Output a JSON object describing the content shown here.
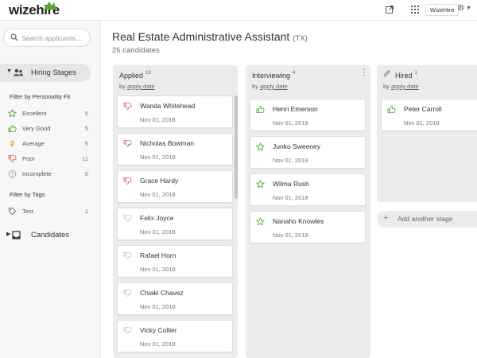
{
  "brand": {
    "logo_text": "wizehire",
    "accent": "#5aa832"
  },
  "topbar": {
    "org_label": "WizeHire"
  },
  "sidebar": {
    "search_placeholder": "Search applicants...",
    "hiring_stages_label": "Hiring Stages",
    "filter_fit_label": "Filter by Personality Fit",
    "fit_filters": [
      {
        "name": "Excellent",
        "count": "5",
        "icon": "star-icon",
        "color": "#5aa832"
      },
      {
        "name": "Very Good",
        "count": "5",
        "icon": "thumbs-up-icon",
        "color": "#5aa832"
      },
      {
        "name": "Average",
        "count": "5",
        "icon": "lightning-icon",
        "color": "#e2a521"
      },
      {
        "name": "Poor",
        "count": "11",
        "icon": "thumbs-down-icon",
        "color": "#e06a6a"
      },
      {
        "name": "Incomplete",
        "count": "0",
        "icon": "question-circle-icon",
        "color": "#999999"
      }
    ],
    "filter_tags_label": "Filter by Tags",
    "tags": [
      {
        "name": "Test",
        "count": "1",
        "icon": "tag-icon"
      }
    ],
    "candidates_label": "Candidates"
  },
  "job": {
    "title": "Real Estate Administrative Assistant",
    "location": "(TX)",
    "candidate_count": "26 candidates"
  },
  "columns": [
    {
      "name": "Applied",
      "count": "19",
      "sort_prefix": "by",
      "sort_label": "apply date",
      "cards": [
        {
          "name": "Wanda Whitehead",
          "date": "Nov 01, 2018",
          "icon": "thumbs-down-icon"
        },
        {
          "name": "Nicholas Bowman",
          "date": "Nov 01, 2018",
          "icon": "thumbs-down-icon"
        },
        {
          "name": "Grace Hardy",
          "date": "Nov 01, 2018",
          "icon": "thumbs-down-icon"
        },
        {
          "name": "Felix Joyce",
          "date": "Nov 01, 2018",
          "icon": "thumbs-down-icon"
        },
        {
          "name": "Rafael Horn",
          "date": "Nov 01, 2018",
          "icon": "thumbs-down-icon"
        },
        {
          "name": "Chiaki Chavez",
          "date": "Nov 01, 2018",
          "icon": "thumbs-down-icon"
        },
        {
          "name": "Vicky Collier",
          "date": "Nov 01, 2018",
          "icon": "thumbs-down-icon"
        }
      ]
    },
    {
      "name": "Interviewing",
      "count": "4",
      "sort_prefix": "by",
      "sort_label": "apply date",
      "cards": [
        {
          "name": "Henri Emerson",
          "date": "Nov 01, 2018",
          "icon": "thumbs-up-icon"
        },
        {
          "name": "Junko Sweeney",
          "date": "Nov 01, 2018",
          "icon": "star-icon"
        },
        {
          "name": "Wilma Rush",
          "date": "Nov 01, 2018",
          "icon": "star-icon"
        },
        {
          "name": "Nanaho Knowles",
          "date": "Nov 01, 2018",
          "icon": "star-icon"
        }
      ]
    },
    {
      "name": "Hired",
      "count": "1",
      "sort_prefix": "by",
      "sort_label": "apply date",
      "cards": [
        {
          "name": "Peter Carroll",
          "date": "Nov 01, 2018",
          "icon": "thumbs-up-icon"
        }
      ]
    }
  ],
  "add_stage_label": "Add another stage"
}
